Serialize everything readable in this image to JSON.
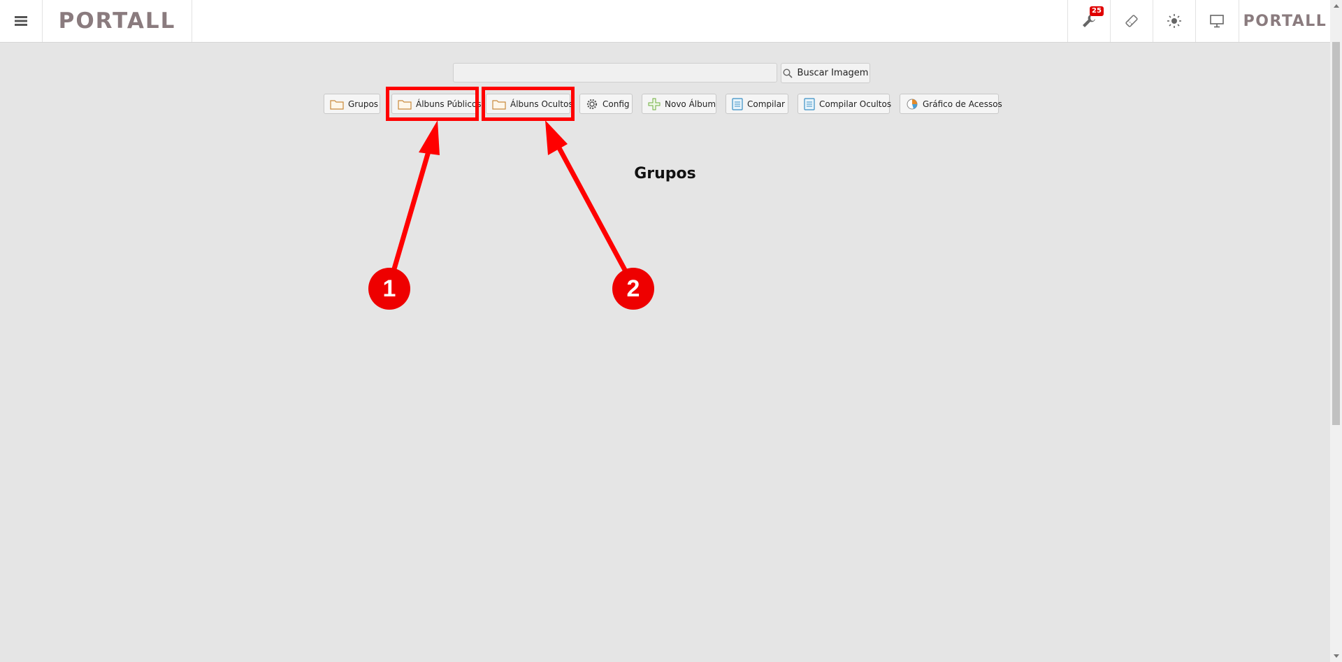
{
  "header": {
    "logo_left": "PORTALL",
    "logo_right": "PORTALL",
    "notifications_badge": "25",
    "icons": [
      "menu-icon",
      "wrench-icon",
      "ticket-icon",
      "sun-icon",
      "monitor-icon"
    ]
  },
  "search": {
    "value": "",
    "placeholder": "",
    "button_label": "Buscar Imagem"
  },
  "toolbar": {
    "grupos": "Grupos",
    "albuns_publicos": "Álbuns Públicos",
    "albuns_ocultos": "Álbuns Ocultos",
    "config": "Config",
    "novo_album": "Novo Álbum",
    "compilar": "Compilar",
    "compilar_ocultos": "Compilar Ocultos",
    "grafico_acessos": "Gráfico de Acessos"
  },
  "main": {
    "title": "Grupos"
  },
  "annotations": {
    "marker_1": "1",
    "marker_2": "2",
    "color": "#ff0000"
  }
}
